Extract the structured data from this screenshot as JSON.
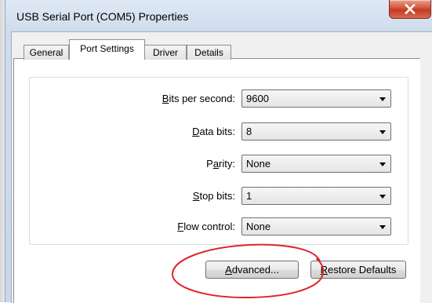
{
  "window": {
    "title": "USB Serial Port (COM5) Properties"
  },
  "tabs": [
    {
      "label": "General",
      "active": false
    },
    {
      "label": "Port Settings",
      "active": true
    },
    {
      "label": "Driver",
      "active": false
    },
    {
      "label": "Details",
      "active": false
    }
  ],
  "fields": {
    "bits_per_second": {
      "mnemonic": "B",
      "label_rest": "its per second:",
      "value": "9600"
    },
    "data_bits": {
      "mnemonic": "D",
      "label_rest": "ata bits:",
      "value": "8"
    },
    "parity": {
      "label_pre": "P",
      "mnemonic": "a",
      "label_rest": "rity:",
      "value": "None"
    },
    "stop_bits": {
      "mnemonic": "S",
      "label_rest": "top bits:",
      "value": "1"
    },
    "flow_control": {
      "mnemonic": "F",
      "label_rest": "low control:",
      "value": "None"
    }
  },
  "buttons": {
    "advanced_mnemonic": "A",
    "advanced_rest": "dvanced...",
    "restore_mnemonic": "R",
    "restore_rest": "estore Defaults"
  },
  "annotation_color": "#e0252b",
  "close_icon": "close-icon"
}
